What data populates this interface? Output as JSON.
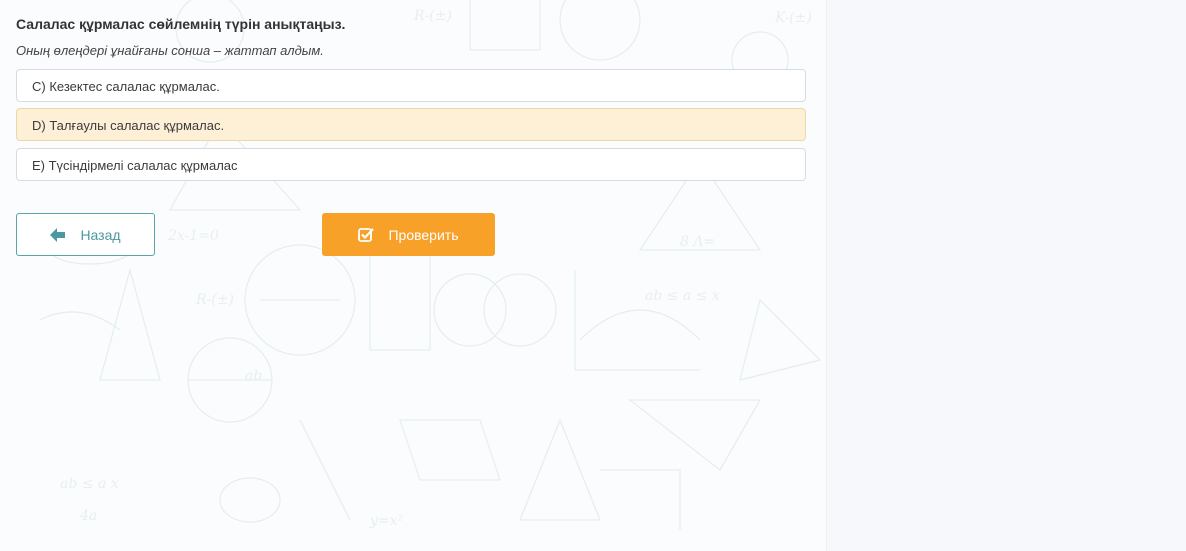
{
  "question": {
    "title": "Салалас құрмалас сөйлемнің түрін анықтаңыз.",
    "sentence": "Оның өлеңдері ұнайғаны сонша – жаттап алдым."
  },
  "options": [
    {
      "label": "C) Кезектес салалас құрмалас.",
      "selected": false
    },
    {
      "label": "D) Талғаулы салалас құрмалас.",
      "selected": true
    },
    {
      "label": "E) Түсіндірмелі салалас құрмалас",
      "selected": false
    }
  ],
  "buttons": {
    "back_label": "Назад",
    "check_label": "Проверить"
  },
  "colors": {
    "accent_orange": "#f8a129",
    "accent_teal": "#58a5ae",
    "selected_bg": "#fdf0d6"
  },
  "icons": {
    "back": "arrow-left-icon",
    "check": "check-square-icon"
  }
}
